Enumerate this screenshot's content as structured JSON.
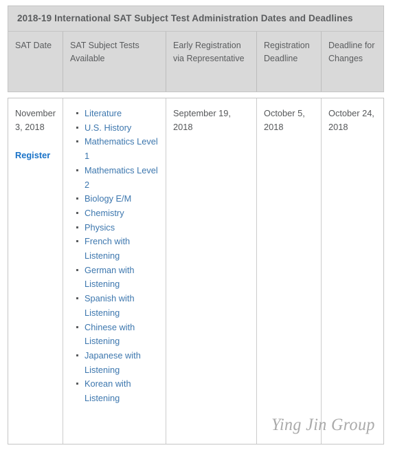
{
  "table": {
    "caption": "2018-19 International SAT Subject Test Administration Dates and Deadlines",
    "columns": [
      "SAT Date",
      "SAT Subject Tests Available",
      "Early Registration via Representative",
      "Registration Deadline",
      "Deadline for Changes"
    ],
    "rows": [
      {
        "sat_date": "November 3, 2018",
        "register_label": "Register",
        "subjects": [
          "Literature",
          "U.S. History",
          "Mathematics Level 1",
          "Mathematics Level 2",
          "Biology E/M",
          "Chemistry",
          "Physics",
          "French with Listening",
          "German with Listening",
          "Spanish with Listening",
          "Chinese with Listening",
          "Japanese with Listening",
          "Korean with Listening"
        ],
        "early_registration": "September 19, 2018",
        "registration_deadline": "October 5, 2018",
        "deadline_for_changes": "October 24, 2018"
      }
    ]
  },
  "watermark": {
    "text": "Ying Jin Group"
  },
  "colors": {
    "header_background": "#d9d9d9",
    "border": "#c4c4c4",
    "text": "#555759",
    "link": "#3d77ae",
    "register_link": "#1a73c8",
    "watermark": "#9b9b9b"
  }
}
